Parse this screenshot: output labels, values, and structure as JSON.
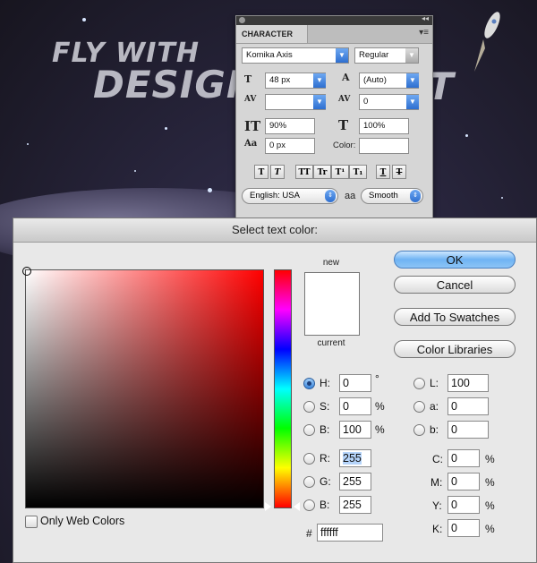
{
  "background": {
    "headline_line1": "FLY WITH",
    "headline_line2": "DESIGN",
    "headline_partial": "T"
  },
  "character_panel": {
    "tab_label": "CHARACTER",
    "font_family": "Komika Axis",
    "font_style": "Regular",
    "font_size": "48 px",
    "leading": "(Auto)",
    "kerning": "",
    "tracking": "0",
    "vertical_scale": "90%",
    "horizontal_scale": "100%",
    "baseline_shift": "0 px",
    "color_label": "Color:",
    "style_buttons": [
      "T",
      "T",
      "TT",
      "Tr",
      "T¹",
      "T₁",
      "T",
      "T"
    ],
    "language": "English: USA",
    "antialias_icon_text": "aa",
    "antialias": "Smooth"
  },
  "color_picker": {
    "title": "Select text color:",
    "new_label": "new",
    "current_label": "current",
    "new_color": "#ffffff",
    "current_color": "#ffffff",
    "buttons": {
      "ok": "OK",
      "cancel": "Cancel",
      "add_to_swatches": "Add To Swatches",
      "color_libraries": "Color Libraries"
    },
    "hsb": [
      {
        "label": "H:",
        "value": "0",
        "unit": "°"
      },
      {
        "label": "S:",
        "value": "0",
        "unit": "%"
      },
      {
        "label": "B:",
        "value": "100",
        "unit": "%"
      }
    ],
    "rgb": [
      {
        "label": "R:",
        "value": "255"
      },
      {
        "label": "G:",
        "value": "255"
      },
      {
        "label": "B:",
        "value": "255"
      }
    ],
    "lab": [
      {
        "label": "L:",
        "value": "100"
      },
      {
        "label": "a:",
        "value": "0"
      },
      {
        "label": "b:",
        "value": "0"
      }
    ],
    "cmyk": [
      {
        "label": "C:",
        "value": "0",
        "unit": "%"
      },
      {
        "label": "M:",
        "value": "0",
        "unit": "%"
      },
      {
        "label": "Y:",
        "value": "0",
        "unit": "%"
      },
      {
        "label": "K:",
        "value": "0",
        "unit": "%"
      }
    ],
    "hex_label": "#",
    "hex_value": "ffffff",
    "only_web_colors_label": "Only Web Colors",
    "only_web_colors": false,
    "selected_mode": "H"
  }
}
